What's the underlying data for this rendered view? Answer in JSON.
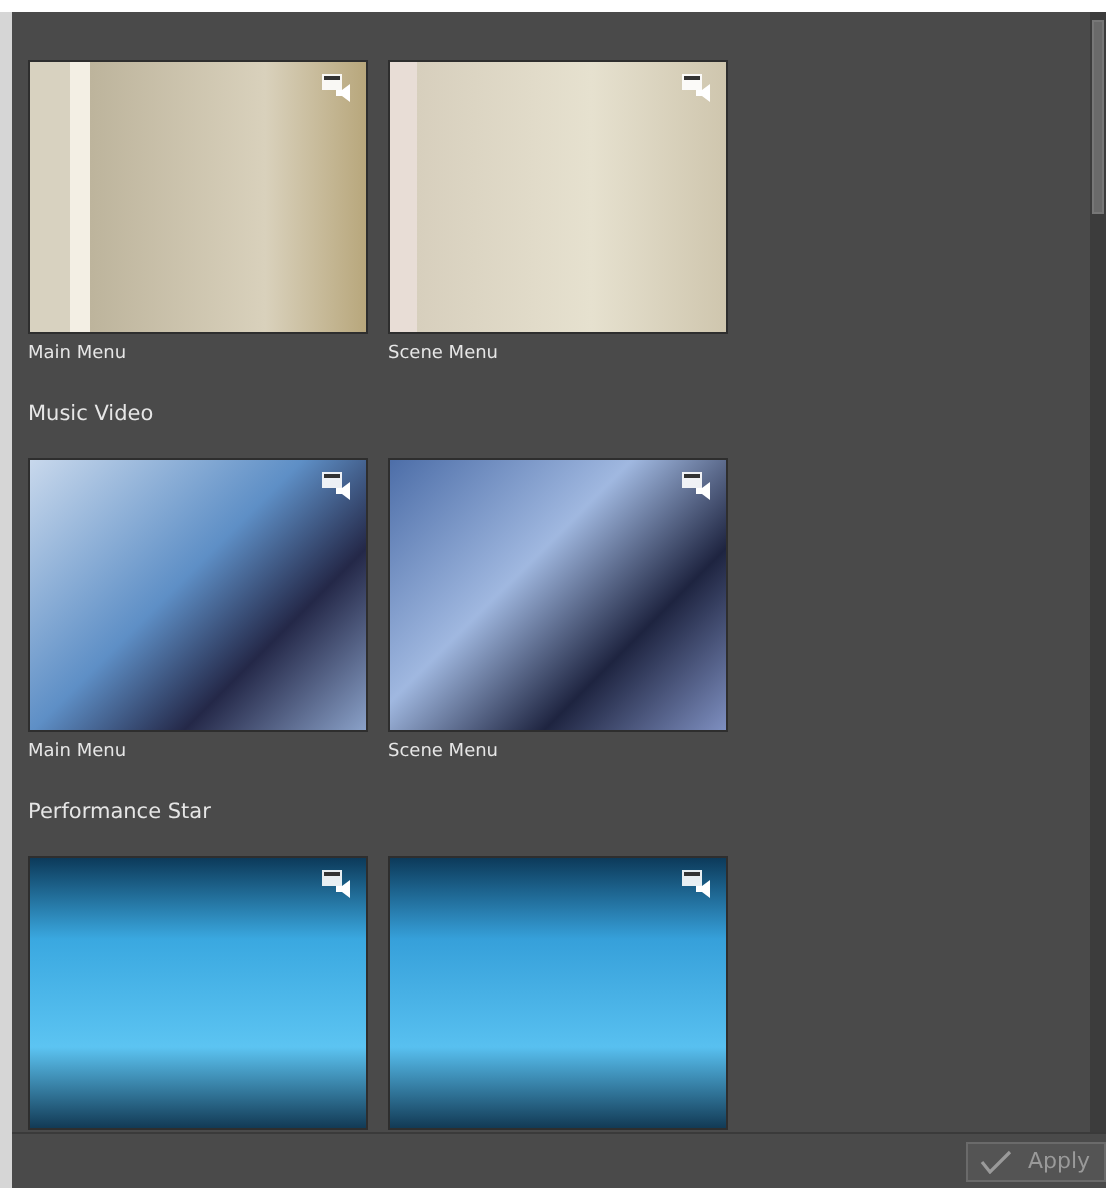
{
  "categories": [
    {
      "kind": "classic",
      "templates": [
        {
          "caption": "Main Menu",
          "kind": "main"
        },
        {
          "caption": "Scene Menu",
          "kind": "scene"
        }
      ]
    },
    {
      "name": "Music Video",
      "kind": "music",
      "templates": [
        {
          "caption": "Main Menu",
          "kind": "main"
        },
        {
          "caption": "Scene Menu",
          "kind": "scene"
        }
      ]
    },
    {
      "name": "Performance Star",
      "kind": "performance",
      "templates": [
        {
          "kind": "main"
        },
        {
          "kind": "scene"
        }
      ]
    }
  ],
  "apply_button": {
    "label": "Apply",
    "disabled": true
  }
}
